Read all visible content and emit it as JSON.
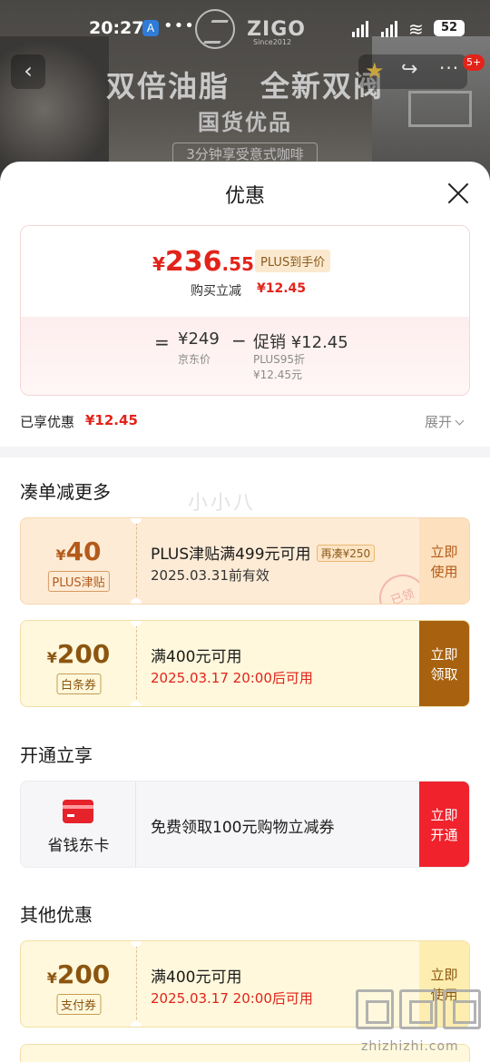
{
  "status_bar": {
    "time": "20:27",
    "app_icon": "A",
    "dots": "•••",
    "battery": "52"
  },
  "background": {
    "brand": {
      "name": "ZIGO",
      "since": "Since2012"
    },
    "hero": {
      "line1": "双倍油脂　全新双阀",
      "line2": "国货优品",
      "line3": "3分钟享受意式咖啡"
    },
    "nav": {
      "back_icon": "‹",
      "star_icon": "★",
      "share_icon": "↪",
      "more_icon": "···",
      "badge": "5+"
    }
  },
  "sheet": {
    "title": "优惠",
    "close_icon": "close-icon",
    "price_card": {
      "currency": "¥",
      "price_int": "236",
      "price_dec": ".55",
      "plus_tag": "PLUS到手价",
      "instant_label": "购买立减",
      "instant_value": "¥12.45",
      "eq": "=",
      "jd_price": "¥249",
      "jd_price_label": "京东价",
      "minus": "−",
      "promo_label": "促销 ¥12.45",
      "promo_sub1": "PLUS95折",
      "promo_sub2": "¥12.45元"
    },
    "enjoyed": {
      "label": "已享优惠",
      "value": "¥12.45",
      "expand": "展开"
    },
    "sections": {
      "more": "凑单减更多",
      "open": "开通立享",
      "other": "其他优惠"
    },
    "coupons": [
      {
        "currency": "¥",
        "amount": "40",
        "tag": "PLUS津贴",
        "title": "PLUS津贴满499元可用",
        "extra": "再凑¥250",
        "sub": "2025.03.31前有效",
        "action1": "立即",
        "action2": "使用",
        "stamp": "已领"
      },
      {
        "currency": "¥",
        "amount": "200",
        "tag": "白条券",
        "title": "满400元可用",
        "sub": "2025.03.17 20:00后可用",
        "action1": "立即",
        "action2": "领取"
      },
      {
        "currency": "¥",
        "amount": "200",
        "tag": "支付券",
        "title": "满400元可用",
        "sub": "2025.03.17 20:00后可用",
        "action1": "立即",
        "action2": "使用"
      }
    ],
    "member_card": {
      "name": "省钱东卡",
      "desc": "免费领取100元购物立减券",
      "action1": "立即",
      "action2": "开通"
    }
  },
  "watermarks": {
    "mid": "小小八",
    "site": "zhizhizhi.com"
  },
  "colors": {
    "accent_red": "#e2231a",
    "gold": "#a8620f",
    "plus_orange": "#b35a1a"
  }
}
